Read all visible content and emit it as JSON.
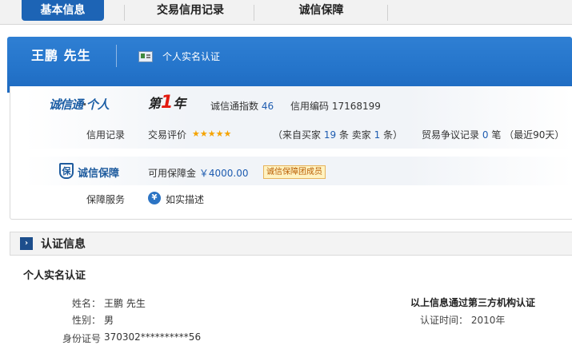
{
  "tabs": [
    {
      "label": "基本信息",
      "active": true
    },
    {
      "label": "交易信用记录",
      "active": false
    },
    {
      "label": "诚信保障",
      "active": false
    }
  ],
  "header": {
    "user_name": "王鹏 先生",
    "verify_label": "个人实名认证"
  },
  "credit": {
    "logo_main": "诚信通",
    "logo_dot": "·",
    "logo_person": "个人",
    "rank_prefix": "第",
    "rank_num": "1",
    "rank_suffix": "年",
    "index_label": "诚信通指数",
    "index_value": "46",
    "code_label": "信用编码",
    "code_value": "17168199"
  },
  "record": {
    "label": "信用记录",
    "rating_label": "交易评价",
    "stars": "★★★★★",
    "src_open": "（来自买家",
    "buyer_count": "19",
    "src_mid": "条  卖家",
    "seller_count": "1",
    "src_close": "条）",
    "dispute_label": "贸易争议记录",
    "dispute_count": "0",
    "dispute_unit": "笔",
    "dispute_period": "（最近90天）"
  },
  "guarantee": {
    "icon_char": "保",
    "title": "诚信保障",
    "deposit_label": "可用保障金",
    "deposit_value": "￥4000.00",
    "badge": "诚信保障团成员",
    "service_label": "保障服务",
    "service_icon": "¥",
    "service_value": "如实描述"
  },
  "auth": {
    "arrow": "›",
    "title": "认证信息",
    "subtitle": "个人实名认证",
    "fields": [
      {
        "label": "姓名：",
        "value": "王鹏 先生"
      },
      {
        "label": "性别：",
        "value": "男"
      },
      {
        "label": "身份证号",
        "value": "370302**********56"
      }
    ],
    "third_party_note": "以上信息通过第三方机构认证",
    "time_label": "认证时间：",
    "time_value": "2010年"
  }
}
